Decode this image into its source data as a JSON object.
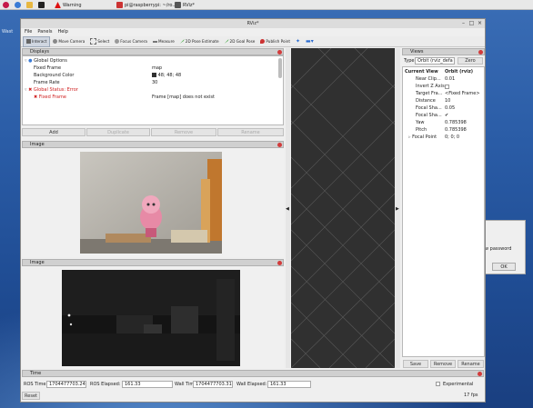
{
  "taskbar": {
    "items": [
      {
        "label": ""
      },
      {
        "label": "Warning"
      },
      {
        "label": "pi@raspberrypi: ~/ro..."
      },
      {
        "label": "RViz*"
      }
    ]
  },
  "window": {
    "title": "RViz*",
    "menu": [
      "File",
      "Panels",
      "Help"
    ],
    "toolbar": [
      "Interact",
      "Move Camera",
      "Select",
      "Focus Camera",
      "Measure",
      "2D Pose Estimate",
      "2D Goal Pose",
      "Publish Point"
    ]
  },
  "displays": {
    "title": "Displays",
    "rows": [
      {
        "label": "Global Options",
        "value": ""
      },
      {
        "label": "Fixed Frame",
        "value": "map"
      },
      {
        "label": "Background Color",
        "value": "48; 48; 48"
      },
      {
        "label": "Frame Rate",
        "value": "30"
      },
      {
        "label": "Global Status: Error",
        "value": ""
      },
      {
        "label": "Fixed Frame",
        "value": "Frame [map] does not exist"
      }
    ],
    "buttons": {
      "add": "Add",
      "duplicate": "Duplicate",
      "remove": "Remove",
      "rename": "Rename"
    }
  },
  "image1": {
    "title": "Image"
  },
  "image2": {
    "title": "Image"
  },
  "views": {
    "title": "Views",
    "type_label": "Type:",
    "type_value": "Orbit (rviz_defa",
    "zero": "Zero",
    "current_view_label": "Current View",
    "current_view_value": "Orbit (rviz)",
    "rows": [
      {
        "label": "Near Clip...",
        "value": "0.01"
      },
      {
        "label": "Invert Z Axis",
        "value": ""
      },
      {
        "label": "Target Fra...",
        "value": "<Fixed Frame>"
      },
      {
        "label": "Distance",
        "value": "10"
      },
      {
        "label": "Focal Sha...",
        "value": "0.05"
      },
      {
        "label": "Focal Sha...",
        "value": "✔"
      },
      {
        "label": "Yaw",
        "value": "0.785398"
      },
      {
        "label": "Pitch",
        "value": "0.785398"
      },
      {
        "label": "Focal Point",
        "value": "0; 0; 0"
      }
    ],
    "buttons": {
      "save": "Save",
      "remove": "Remove",
      "rename": "Rename"
    }
  },
  "time": {
    "title": "Time",
    "ros_time_label": "ROS Time:",
    "ros_time": "1704477703.24",
    "ros_elapsed_label": "ROS Elapsed:",
    "ros_elapsed": "161.33",
    "wall_time_label": "Wall Time:",
    "wall_time": "1704477703.31",
    "wall_elapsed_label": "Wall Elapsed:",
    "wall_elapsed": "161.33",
    "experimental": "Experimental",
    "reset": "Reset",
    "fps": "17 fps"
  },
  "side_dialog": {
    "text": "w password",
    "ok": "OK"
  },
  "desktop_label": "Wast"
}
